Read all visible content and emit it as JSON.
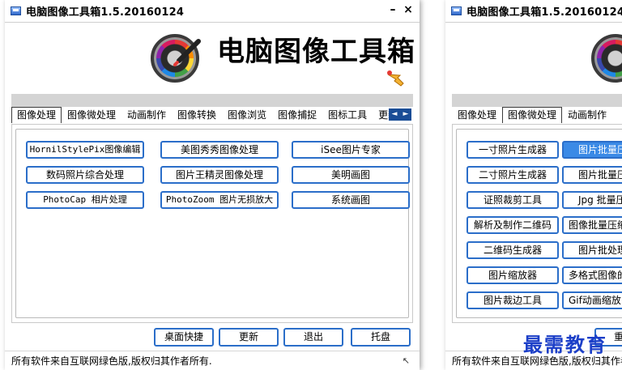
{
  "window_a": {
    "title": "电脑图像工具箱1.5.20160124",
    "minimize": "–",
    "close": "×",
    "big_title": "电脑图像工具箱",
    "tabs": [
      "图像处理",
      "图像微处理",
      "动画制作",
      "图像转换",
      "图像浏览",
      "图像捕捉",
      "图标工具",
      "更新"
    ],
    "tab_scroll": [
      "◄",
      "►"
    ],
    "tools": [
      "HornilStylePix图像编辑",
      "美图秀秀图像处理",
      "iSee图片专家",
      "数码照片综合处理",
      "图片王精灵图像处理",
      "美明画图",
      "PhotoCap 相片处理",
      "PhotoZoom 图片无损放大",
      "系统画图"
    ],
    "bottom_buttons": [
      "桌面快捷",
      "更新",
      "退出",
      "托盘"
    ],
    "status": "所有软件来自互联网绿色版,版权归其作者所有."
  },
  "window_b": {
    "title": "电脑图像工具箱1.5.20160124",
    "tabs": [
      "图像处理",
      "图像微处理",
      "动画制作"
    ],
    "tools_left": [
      "一寸照片生成器",
      "二寸照片生成器",
      "证照裁剪工具",
      "解析及制作二维码",
      "二维码生成器",
      "图片缩放器",
      "图片裁边工具"
    ],
    "tools_right": [
      "图片批量压",
      "图片批量压",
      "Jpg 批量压",
      "图像批量压缩",
      "图片批处理",
      "多格式图像的",
      "Gif动画缩放"
    ],
    "bottom_partial": "重",
    "status": "所有软件来自互联网绿色版,版权归其作者所有."
  },
  "watermark": "最需教育",
  "colors": {
    "accent": "#2b6ec9",
    "selected": "#3b8ae6",
    "scroll": "#1a4d96",
    "watermark": "#1c3fc8"
  }
}
